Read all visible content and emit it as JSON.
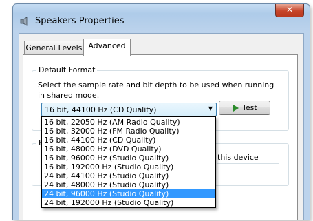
{
  "window": {
    "title": "Speakers Properties",
    "close_label": "✕"
  },
  "tabs": [
    {
      "label": "General",
      "active": false
    },
    {
      "label": "Levels",
      "active": false
    },
    {
      "label": "Advanced",
      "active": true
    }
  ],
  "default_format": {
    "group_label": "Default Format",
    "description_line1": "Select the sample rate and bit depth to be used when running",
    "description_line2": "in shared mode.",
    "selected_value": "16 bit, 44100 Hz (CD Quality)",
    "test_label": "Test"
  },
  "dropdown": {
    "options": [
      "16 bit, 22050 Hz (AM Radio Quality)",
      "16 bit, 32000 Hz (FM Radio Quality)",
      "16 bit, 44100 Hz (CD Quality)",
      "16 bit, 48000 Hz (DVD Quality)",
      "16 bit, 96000 Hz (Studio Quality)",
      "16 bit, 192000 Hz (Studio Quality)",
      "24 bit, 44100 Hz (Studio Quality)",
      "24 bit, 48000 Hz (Studio Quality)",
      "24 bit, 96000 Hz (Studio Quality)",
      "24 bit, 192000 Hz (Studio Quality)"
    ],
    "highlighted": "24 bit, 96000 Hz (Studio Quality)"
  },
  "exclusive_mode": {
    "group_label_fragment": "E",
    "text_fragment": "this device"
  },
  "colors": {
    "highlight": "#3399ff",
    "close_button": "#c7452a",
    "play_icon": "#2a8a2a"
  }
}
